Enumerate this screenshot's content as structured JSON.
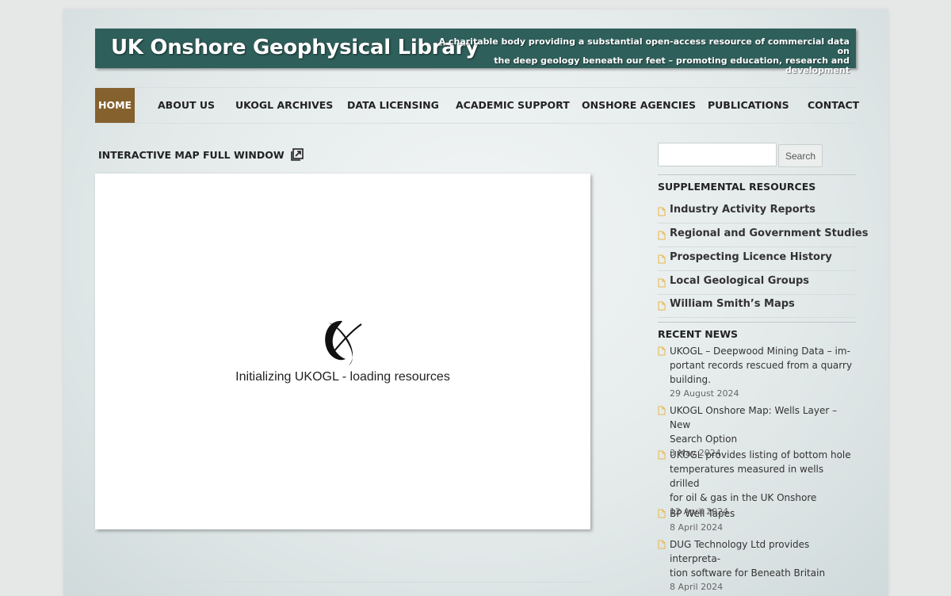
{
  "banner": {
    "title": "UK Onshore Geophysical Library",
    "tagline_line1": "A charitable body providing a substantial open-access resource of commercial data on",
    "tagline_line2": "the deep geology beneath our feet – promoting education, research and development"
  },
  "nav": {
    "items": [
      "HOME",
      "ABOUT US",
      "UKOGL ARCHIVES",
      "DATA LICENSING",
      "ACADEMIC SUPPORT",
      "ONSHORE AGENCIES",
      "PUBLICATIONS",
      "CONTACT"
    ],
    "active": "HOME"
  },
  "map": {
    "link_label": "INTERACTIVE MAP FULL WINDOW",
    "loading_text": "Initializing UKOGL - loading resources"
  },
  "search": {
    "value": "",
    "button_label": "Search"
  },
  "supplemental": {
    "heading": "SUPPLEMENTAL RESOURCES",
    "items": [
      "Industry Activity Reports",
      "Regional and Government Studies",
      "Prospecting Licence History",
      "Local Geological Groups",
      "William Smith’s Maps"
    ]
  },
  "news": {
    "heading": "RECENT NEWS",
    "items": [
      {
        "title_lines": [
          "UKOGL – Deepwood Mining Data – im-",
          "portant records rescued from a quarry",
          "building."
        ],
        "date": "29 August 2024"
      },
      {
        "title_lines": [
          "UKOGL Onshore Map: Wells Layer – New",
          "Search Option"
        ],
        "date": "3 May 2024"
      },
      {
        "title_lines": [
          "UKOGL provides listing of bottom hole",
          "temperatures measured in wells drilled",
          "for oil & gas in the UK Onshore"
        ],
        "date": "12 April 2024"
      },
      {
        "title_lines": [
          "BP Well Tapes"
        ],
        "date": "8 April 2024"
      },
      {
        "title_lines": [
          "DUG Technology Ltd provides interpreta-",
          "tion software for Beneath Britain"
        ],
        "date": "8 April 2024"
      }
    ]
  },
  "colors": {
    "banner_bg": "#2f5f5b",
    "nav_active_bg": "#85612e",
    "doc_icon": "#e8b84a"
  }
}
